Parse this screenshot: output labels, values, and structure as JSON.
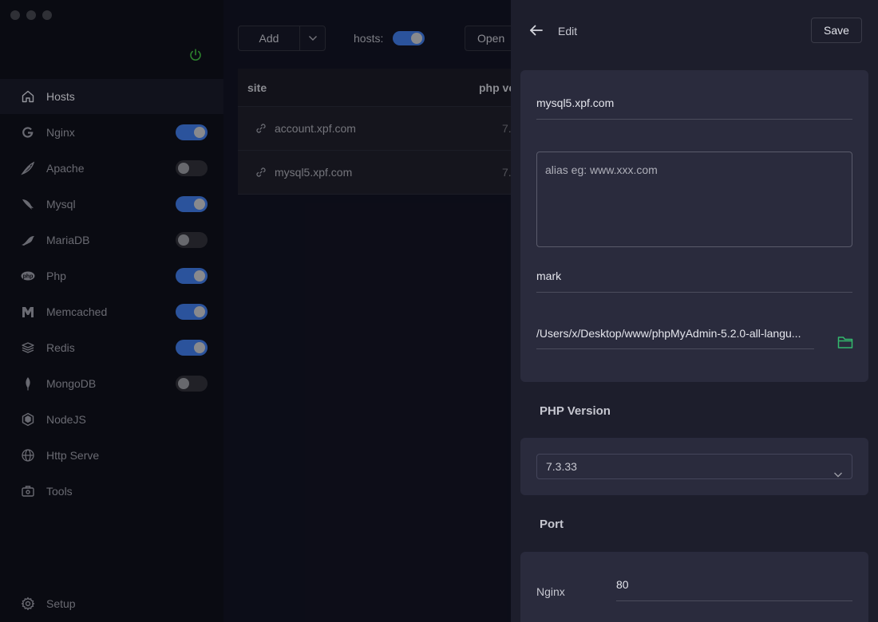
{
  "sidebar": {
    "items": [
      {
        "label": "Hosts",
        "icon": "home-icon",
        "active": true,
        "toggle": null
      },
      {
        "label": "Nginx",
        "icon": "nginx-icon",
        "active": false,
        "toggle": true
      },
      {
        "label": "Apache",
        "icon": "apache-feather-icon",
        "active": false,
        "toggle": false
      },
      {
        "label": "Mysql",
        "icon": "mysql-dolphin-icon",
        "active": false,
        "toggle": true
      },
      {
        "label": "MariaDB",
        "icon": "mariadb-seal-icon",
        "active": false,
        "toggle": false
      },
      {
        "label": "Php",
        "icon": "php-icon",
        "active": false,
        "toggle": true
      },
      {
        "label": "Memcached",
        "icon": "memcached-icon",
        "active": false,
        "toggle": true
      },
      {
        "label": "Redis",
        "icon": "redis-stack-icon",
        "active": false,
        "toggle": true
      },
      {
        "label": "MongoDB",
        "icon": "mongodb-leaf-icon",
        "active": false,
        "toggle": false
      },
      {
        "label": "NodeJS",
        "icon": "nodejs-hexagon-icon",
        "active": false,
        "toggle": null
      },
      {
        "label": "Http Serve",
        "icon": "globe-icon",
        "active": false,
        "toggle": null
      },
      {
        "label": "Tools",
        "icon": "toolbox-icon",
        "active": false,
        "toggle": null
      }
    ],
    "setup_label": "Setup"
  },
  "toolbar": {
    "add_label": "Add",
    "hosts_label": "hosts:",
    "hosts_enabled": true,
    "open_label": "Open"
  },
  "table": {
    "headers": [
      "site",
      "php ve"
    ],
    "rows": [
      {
        "site": "account.xpf.com",
        "php": "7."
      },
      {
        "site": "mysql5.xpf.com",
        "php": "7."
      }
    ]
  },
  "edit": {
    "title": "Edit",
    "save_label": "Save",
    "host_name": "mysql5.xpf.com",
    "alias_placeholder": "alias eg: www.xxx.com",
    "mark": "mark",
    "root_path": "/Users/x/Desktop/www/phpMyAdmin-5.2.0-all-langu...",
    "php_version_label": "PHP Version",
    "php_version": "7.3.33",
    "port_label": "Port",
    "nginx_label": "Nginx",
    "nginx_port": "80"
  },
  "colors": {
    "accent": "#3a6fd0",
    "power_green": "#3cae3c",
    "folder_green": "#33b86d",
    "panel_bg": "#1d1e2c",
    "card_bg": "#2a2b3d"
  }
}
